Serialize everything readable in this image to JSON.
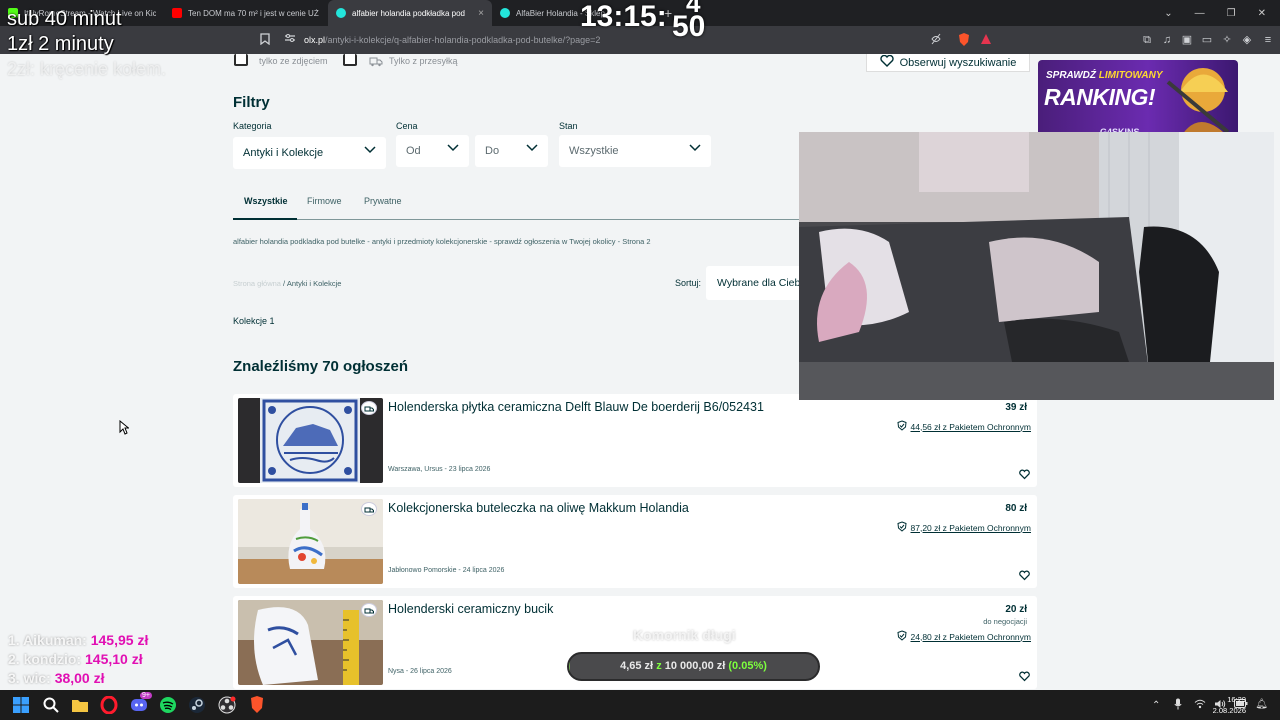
{
  "browser": {
    "tabs": [
      {
        "title": "ItalyRomeStream - Watch Live on Kick",
        "favicon_color": "#53fc18",
        "active": false
      },
      {
        "title": "Ten DOM ma 70 m² i jest w cenie UŻ",
        "favicon_color": "#ff0000",
        "active": false
      },
      {
        "title": "alfabier holandia podkładka pod",
        "favicon_color": "#23e5db",
        "active": true
      },
      {
        "title": "AlfaBier Holandia - Sklep",
        "favicon_color": "#23e5db",
        "active": false
      }
    ],
    "close_glyph": "×",
    "newtab_glyph": "+",
    "url_host": "olx.pl",
    "url_path": "/antyki-i-kolekcje/q-alfabier-holandia-podkladka-pod-butelke/?page=2",
    "window_controls": [
      "⌄",
      "—",
      "❐",
      "✕"
    ]
  },
  "filters": {
    "only_photo_label": "tylko ze zdjęciem",
    "only_shipping_label": "Tylko z przesyłką",
    "observe_label": "Obserwuj wyszukiwanie",
    "heading": "Filtry",
    "category_label": "Kategoria",
    "category_value": "Antyki i Kolekcje",
    "price_label": "Cena",
    "price_from": "Od",
    "price_to": "Do",
    "state_label": "Stan",
    "state_value": "Wszystkie"
  },
  "seller_tabs": [
    "Wszystkie",
    "Firmowe",
    "Prywatne"
  ],
  "seo_text": "alfabier holandia podkladka pod butelke - antyki i przedmioty kolekcjonerskie - sprawdź ogłoszenia w Twojej okolicy - Strona 2",
  "breadcrumb": {
    "home": "Strona główna",
    "separator": "/",
    "current": "Antyki i Kolekcje"
  },
  "sort": {
    "label": "Sortuj:",
    "value": "Wybrane dla Ciebie"
  },
  "subcategory": "Kolekcje 1",
  "found_heading": "Znaleźliśmy 70 ogłoszeń",
  "listings": [
    {
      "title": "Holenderska płytka ceramiczna Delft Blauw De boerderij B6/052431",
      "price": "39 zł",
      "negotiable": "",
      "protection": "44,56 zł z Pakietem Ochronnym",
      "location_date": "Warszawa, Ursus - 23 lipca 2026"
    },
    {
      "title": "Kolekcjonerska buteleczka na oliwę Makkum Holandia",
      "price": "80 zł",
      "negotiable": "",
      "protection": "87,20 zł z Pakietem Ochronnym",
      "location_date": "Jabłonowo Pomorskie - 24 lipca 2026"
    },
    {
      "title": "Holenderski ceramiczny bucik",
      "price": "20 zł",
      "negotiable": "do negocjacji",
      "protection": "24,80 zł z Pakietem Ochronnym",
      "location_date": "Nysa - 26 lipca 2026"
    }
  ],
  "overlay": {
    "sub_line": "sub 40 minut",
    "zl_line": "1zł 2 minuty",
    "wheel_line": "2zł: kręcenie kołem.",
    "clock": "13:15:",
    "clock_seconds": "50",
    "clock_partial": "4",
    "ranking": [
      {
        "name": "1. Aikuman:",
        "amount": "145,95 zł"
      },
      {
        "name": "2. kondzio:",
        "amount": "145,10 zł"
      },
      {
        "name": "3. wic:",
        "amount": "38,00 zł"
      }
    ],
    "promo": {
      "line1_a": "SPRAWDŹ",
      "line1_b": "LIMITOWANY",
      "line2": "RANKING!",
      "brand": "G4SKINS"
    },
    "goal_label": "Komornik długi",
    "goal": {
      "current": "4,65 zł",
      "sep": "z",
      "target": "10 000,00 zł",
      "percent_text": "(0.05%)",
      "fraction": 0.0005
    }
  },
  "taskbar": {
    "time": "16:29",
    "date": "2.08.2026",
    "steam_badge": "9+"
  },
  "colors": {
    "olx_dark": "#002f34",
    "accent_magenta": "#e10fb3",
    "progress_green": "#7dff3e",
    "promo_purple": "#6b2bb0"
  }
}
